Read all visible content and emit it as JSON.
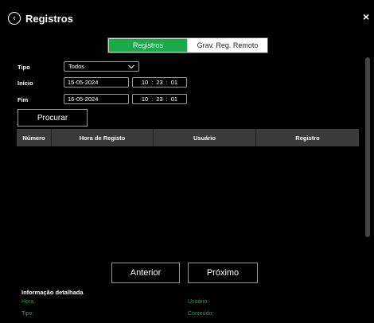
{
  "window": {
    "title": "Registros",
    "close_label": "×"
  },
  "tabs": [
    {
      "label": "Registros",
      "active": true
    },
    {
      "label": "Grav. Reg. Remoto",
      "active": false
    }
  ],
  "filters": {
    "tipo_label": "Tipo",
    "tipo_value": "Todos",
    "inicio_label": "Início",
    "inicio_date": "15-05-2024",
    "inicio_time": [
      "10",
      "23",
      "01"
    ],
    "fim_label": "Fim",
    "fim_date": "16-05-2024",
    "fim_time": [
      "10",
      "23",
      "01"
    ]
  },
  "search_label": "Procurar",
  "table": {
    "columns": [
      "Número",
      "Hora de Registo",
      "Usuário",
      "Registro"
    ],
    "rows": []
  },
  "pagination": {
    "prev_label": "Anterior",
    "next_label": "Próximo"
  },
  "detail": {
    "title": "Informação detalhada",
    "hora_label": "Hora:",
    "usuario_label": "Usuário:",
    "tipo_label": "Tipo:",
    "conteudo_label": "Conteúdo:"
  },
  "colors": {
    "accent": "#1aaa4a",
    "background": "#000000",
    "table_header": "#3a3a3a"
  },
  "icons": {
    "back": "back-circle-icon",
    "close": "close-icon",
    "dropdown": "chevron-down-icon"
  }
}
